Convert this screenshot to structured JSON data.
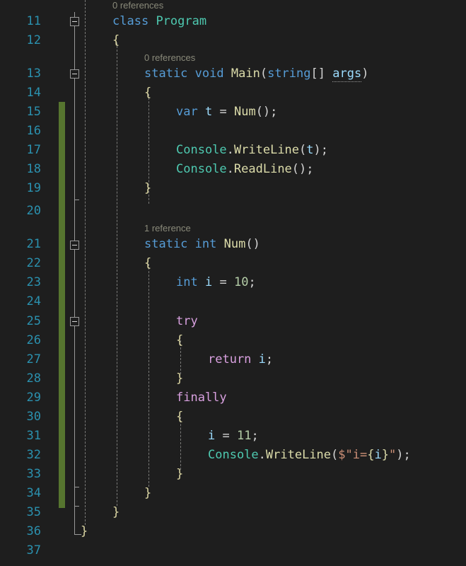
{
  "editor": {
    "language": "csharp",
    "theme": "dark",
    "background_color": "#1e1e1e",
    "line_number_color": "#2b91af",
    "change_bar_color": "#56752f",
    "first_visible_line": 11,
    "last_visible_line": 37
  },
  "gutter": {
    "line_numbers": [
      "11",
      "12",
      "13",
      "14",
      "15",
      "16",
      "17",
      "18",
      "19",
      "20",
      "21",
      "22",
      "23",
      "24",
      "25",
      "26",
      "27",
      "28",
      "29",
      "30",
      "31",
      "32",
      "33",
      "34",
      "35",
      "36",
      "37"
    ],
    "fold_icon": "minus-square-icon",
    "fold_markers": [
      {
        "line": "11",
        "state": "expanded"
      },
      {
        "line": "13",
        "state": "expanded"
      },
      {
        "line": "21",
        "state": "expanded"
      },
      {
        "line": "25",
        "state": "expanded"
      }
    ]
  },
  "codelens": [
    {
      "line": "11",
      "label": "0 references"
    },
    {
      "line": "13",
      "label": "0 references"
    },
    {
      "line": "21",
      "label": "1 reference"
    }
  ],
  "code_lines": [
    {
      "n": "11",
      "text": "class Program"
    },
    {
      "n": "12",
      "text": "{"
    },
    {
      "n": "13",
      "text": "static void Main(string[] args)"
    },
    {
      "n": "14",
      "text": "{"
    },
    {
      "n": "15",
      "text": "var t = Num();"
    },
    {
      "n": "16",
      "text": ""
    },
    {
      "n": "17",
      "text": "Console.WriteLine(t);"
    },
    {
      "n": "18",
      "text": "Console.ReadLine();"
    },
    {
      "n": "19",
      "text": "}"
    },
    {
      "n": "20",
      "text": ""
    },
    {
      "n": "21",
      "text": "static int Num()"
    },
    {
      "n": "22",
      "text": "{"
    },
    {
      "n": "23",
      "text": "int i = 10;"
    },
    {
      "n": "24",
      "text": ""
    },
    {
      "n": "25",
      "text": "try"
    },
    {
      "n": "26",
      "text": "{"
    },
    {
      "n": "27",
      "text": "return i;"
    },
    {
      "n": "28",
      "text": "}"
    },
    {
      "n": "29",
      "text": "finally"
    },
    {
      "n": "30",
      "text": "{"
    },
    {
      "n": "31",
      "text": "i = 11;"
    },
    {
      "n": "32",
      "text": "Console.WriteLine($\"i={i}\");"
    },
    {
      "n": "33",
      "text": "}"
    },
    {
      "n": "34",
      "text": "}"
    },
    {
      "n": "35",
      "text": "}"
    },
    {
      "n": "36",
      "text": "}"
    },
    {
      "n": "37",
      "text": ""
    }
  ],
  "tokens": {
    "ln11": {
      "kw": "class",
      "type": "Program"
    },
    "ln12": {
      "brace": "{"
    },
    "ln13": {
      "kw1": "static",
      "kw2": "void",
      "fn": "Main",
      "p1": "(",
      "kw3": "string",
      "brk": "[]",
      "id": "args",
      "p2": ")"
    },
    "ln14": {
      "brace": "{"
    },
    "ln15": {
      "kw": "var",
      "id": "t",
      "eq": "=",
      "fn": "Num",
      "tail": "();"
    },
    "ln17": {
      "type": "Console",
      "dot": ".",
      "fn": "WriteLine",
      "p1": "(",
      "id": "t",
      "tail": ");"
    },
    "ln18": {
      "type": "Console",
      "dot": ".",
      "fn": "ReadLine",
      "tail": "();"
    },
    "ln19": {
      "brace": "}"
    },
    "ln21": {
      "kw1": "static",
      "kw2": "int",
      "fn": "Num",
      "tail": "()"
    },
    "ln22": {
      "brace": "{"
    },
    "ln23": {
      "kw": "int",
      "id": "i",
      "eq": "=",
      "num": "10",
      "semi": ";"
    },
    "ln25": {
      "ctrl": "try"
    },
    "ln26": {
      "brace": "{"
    },
    "ln27": {
      "ctrl": "return",
      "id": "i",
      "semi": ";"
    },
    "ln28": {
      "brace": "}"
    },
    "ln29": {
      "ctrl": "finally"
    },
    "ln30": {
      "brace": "{"
    },
    "ln31": {
      "id": "i",
      "eq": "=",
      "num": "11",
      "semi": ";"
    },
    "ln32": {
      "type": "Console",
      "dot": ".",
      "fn": "WriteLine",
      "p1": "(",
      "dollar": "$\"",
      "strtext": "i=",
      "ob": "{",
      "id": "i",
      "cb": "}",
      "q": "\"",
      "tail": ");"
    },
    "ln33": {
      "brace": "}"
    },
    "ln34": {
      "brace": "}"
    },
    "ln35": {
      "brace": "}"
    },
    "ln36": {
      "brace": "}"
    }
  },
  "colors": {
    "keyword": "#569cd6",
    "control_keyword": "#d8a0df",
    "type_name": "#4ec9b0",
    "method_name": "#dcdcaa",
    "identifier": "#9cdcfe",
    "number": "#b5cea8",
    "string": "#ce9178",
    "punctuation": "#d4d4d4",
    "brace": "#ddd8a5",
    "codelens_text": "#8a8a7a",
    "indent_guide": "#7a7a78",
    "fold_outline": "#9a9a9a"
  },
  "diagnostics": [
    {
      "line": "13",
      "token": "args",
      "style": "dotted-underline",
      "meaning": "unused-parameter-hint"
    }
  ]
}
